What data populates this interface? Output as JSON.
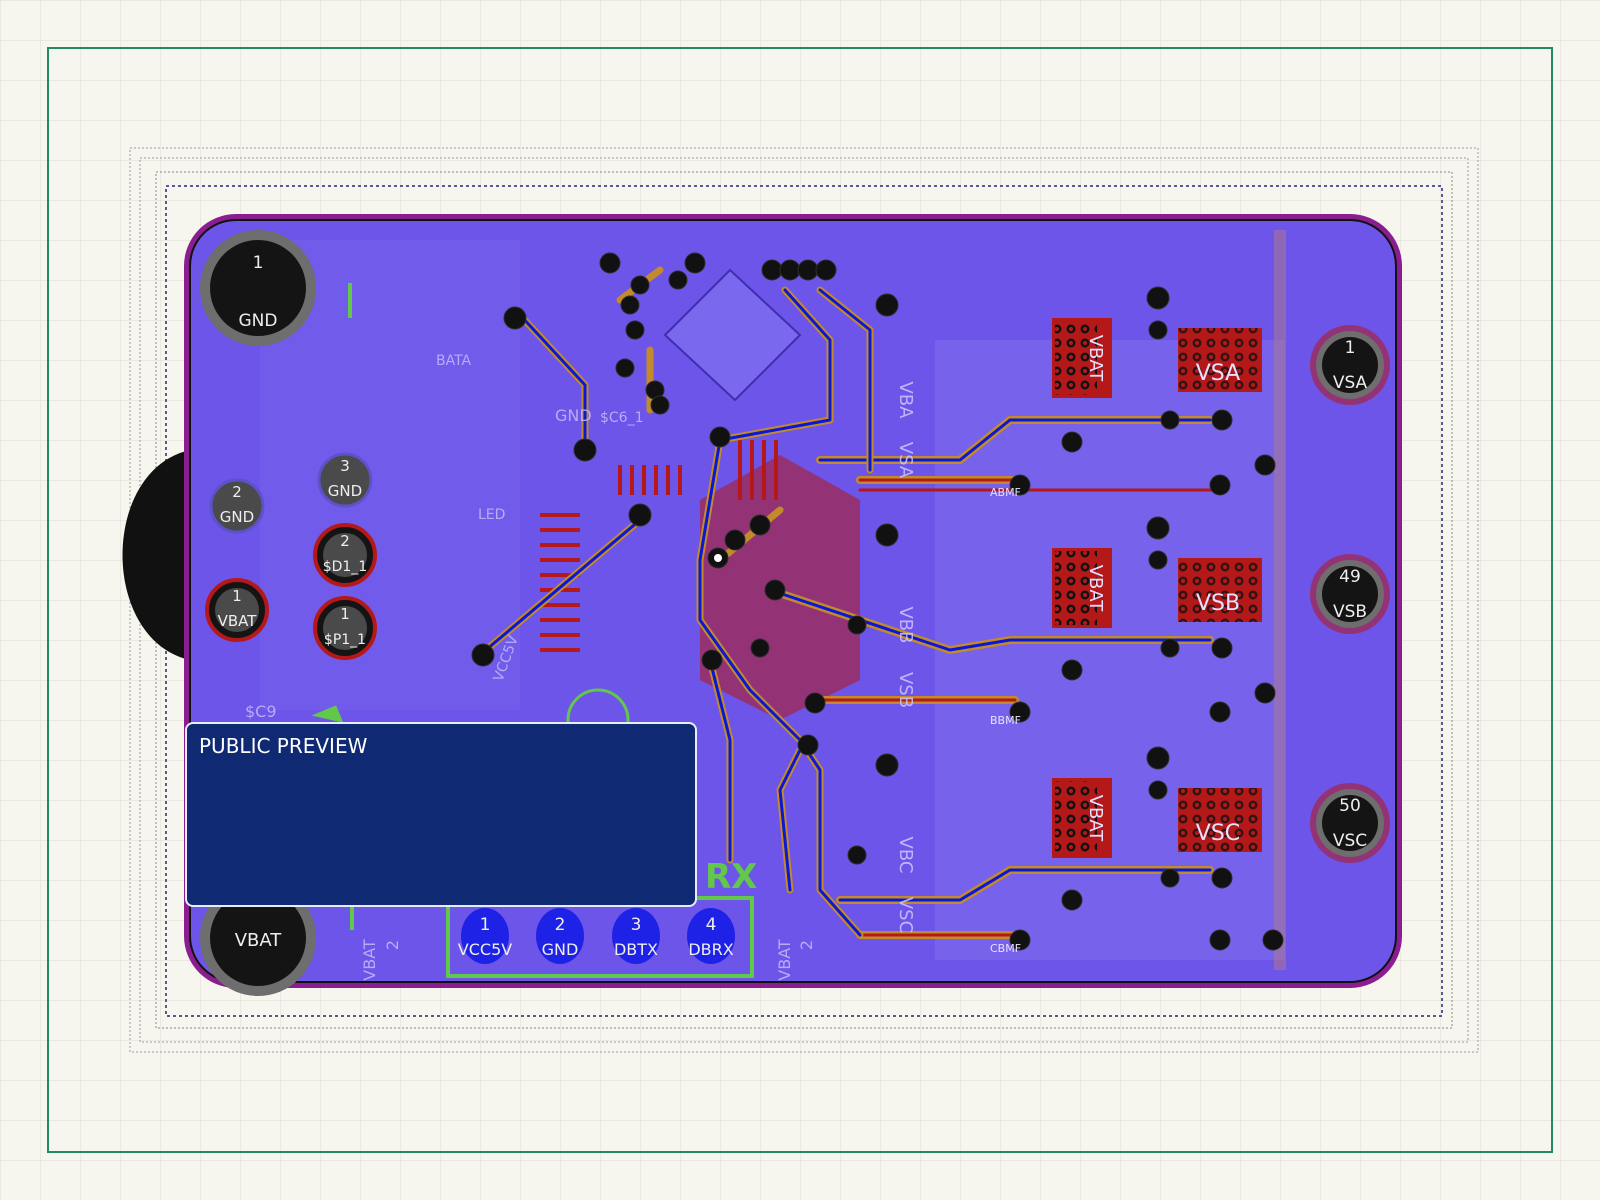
{
  "colors": {
    "background": "#f6f5ee",
    "grid": "#dddcd2",
    "frame": "#1f8a64",
    "board_fill": "#6c55e8",
    "board_outline": "#8a1d8f",
    "copper_red": "#b51818",
    "trace_blue": "#0b17d6",
    "silk_green": "#62c84a",
    "pad_gray": "#4a4a4a",
    "dark": "#101016",
    "preview_bg": "#0f2a72"
  },
  "mounting_holes": [
    {
      "num": "1",
      "label": "GND"
    },
    {
      "num": "",
      "label": "VBAT"
    },
    {
      "num": "1",
      "label": "VSA"
    },
    {
      "num": "49",
      "label": "VSB"
    },
    {
      "num": "50",
      "label": "VSC"
    }
  ],
  "left_pads": [
    {
      "num": "3",
      "label": "GND"
    },
    {
      "num": "2",
      "label": "GND"
    },
    {
      "num": "2",
      "label": "$D1_1"
    },
    {
      "num": "1",
      "label": "VBAT"
    },
    {
      "num": "1",
      "label": "$P1_1"
    }
  ],
  "header_pins": [
    {
      "num": "1",
      "label": "VCC5V"
    },
    {
      "num": "2",
      "label": "GND"
    },
    {
      "num": "3",
      "label": "DBTX"
    },
    {
      "num": "4",
      "label": "DBRX"
    }
  ],
  "header_silkscreen": "RX",
  "connector_groups": [
    {
      "row_label": "VBAT",
      "block_label": "VSA",
      "bottom_label": "ABMF"
    },
    {
      "row_label": "VBAT",
      "block_label": "VSB",
      "bottom_label": "BBMF"
    },
    {
      "row_label": "VBAT",
      "block_label": "VSC",
      "bottom_label": "CBMF"
    }
  ],
  "side_labels": [
    "VBA",
    "VSA",
    "VBB",
    "VSB",
    "VBC",
    "VSC"
  ],
  "small_labels": {
    "batt": "BATA",
    "sc6": "$C6_1",
    "sc9": "$C9",
    "led": "LED",
    "vbat_bottom": "VBAT",
    "vbat_bottom_num": "2",
    "gnd_small": "GND",
    "vcc5v_small": "VCC5V"
  },
  "overlay": {
    "label": "PUBLIC PREVIEW"
  }
}
